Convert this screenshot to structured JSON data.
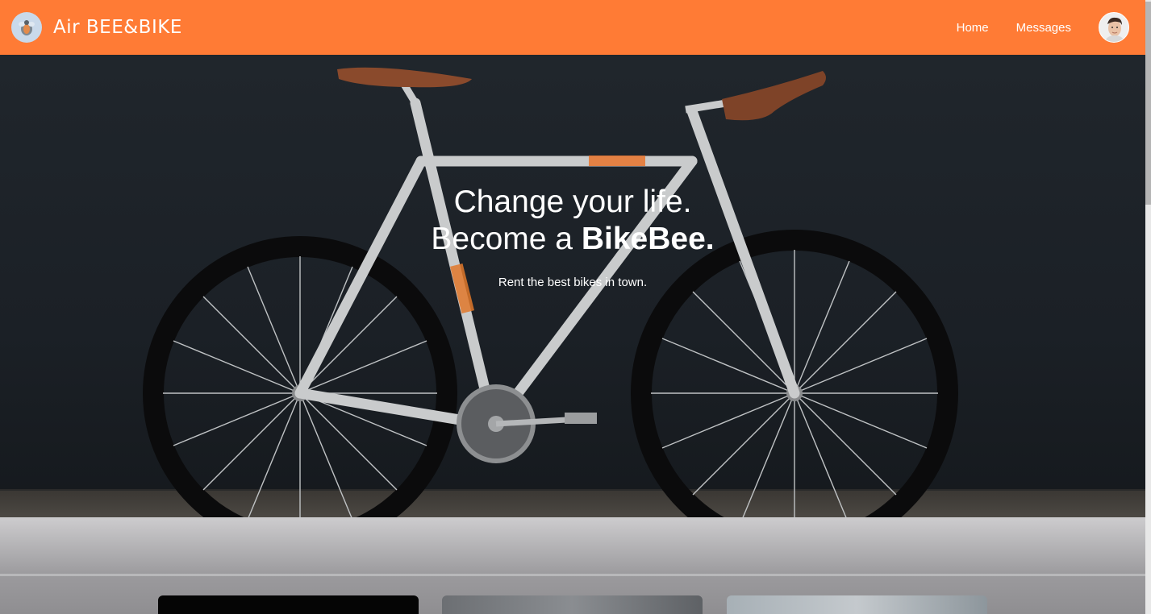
{
  "navbar": {
    "brand_name": "Air BEE&BIKE",
    "logo_icon": "bee-logo-icon",
    "links": [
      {
        "label": "Home"
      },
      {
        "label": "Messages"
      }
    ],
    "avatar_icon": "user-avatar"
  },
  "hero": {
    "headline_line1": "Change your life.",
    "headline_line2_prefix": "Become a ",
    "headline_line2_bold": "BikeBee.",
    "subtitle": "Rent the best bikes in town."
  },
  "listings": {
    "cards": [
      {
        "name": "bike-card-1"
      },
      {
        "name": "bike-card-2"
      },
      {
        "name": "bike-card-3"
      }
    ]
  },
  "colors": {
    "brand_orange": "#ff7b35",
    "hero_background": "#1a1f25"
  }
}
